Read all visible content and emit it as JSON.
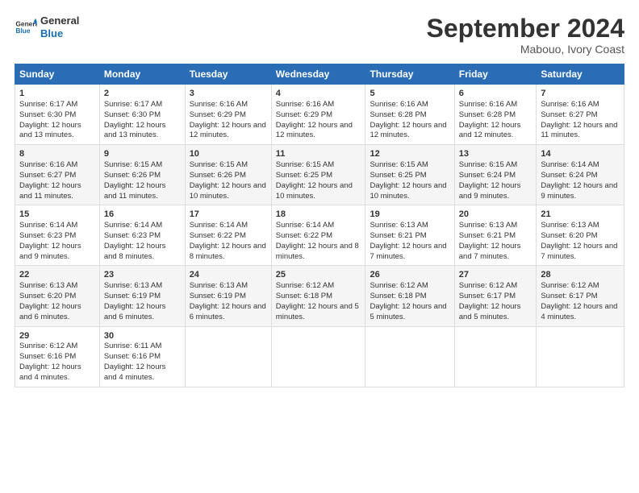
{
  "logo": {
    "text1": "General",
    "text2": "Blue"
  },
  "title": "September 2024",
  "subtitle": "Mabouo, Ivory Coast",
  "days_header": [
    "Sunday",
    "Monday",
    "Tuesday",
    "Wednesday",
    "Thursday",
    "Friday",
    "Saturday"
  ],
  "weeks": [
    [
      {
        "day": "1",
        "sunrise": "6:17 AM",
        "sunset": "6:30 PM",
        "daylight": "12 hours and 13 minutes."
      },
      {
        "day": "2",
        "sunrise": "6:17 AM",
        "sunset": "6:30 PM",
        "daylight": "12 hours and 13 minutes."
      },
      {
        "day": "3",
        "sunrise": "6:16 AM",
        "sunset": "6:29 PM",
        "daylight": "12 hours and 12 minutes."
      },
      {
        "day": "4",
        "sunrise": "6:16 AM",
        "sunset": "6:29 PM",
        "daylight": "12 hours and 12 minutes."
      },
      {
        "day": "5",
        "sunrise": "6:16 AM",
        "sunset": "6:28 PM",
        "daylight": "12 hours and 12 minutes."
      },
      {
        "day": "6",
        "sunrise": "6:16 AM",
        "sunset": "6:28 PM",
        "daylight": "12 hours and 12 minutes."
      },
      {
        "day": "7",
        "sunrise": "6:16 AM",
        "sunset": "6:27 PM",
        "daylight": "12 hours and 11 minutes."
      }
    ],
    [
      {
        "day": "8",
        "sunrise": "6:16 AM",
        "sunset": "6:27 PM",
        "daylight": "12 hours and 11 minutes."
      },
      {
        "day": "9",
        "sunrise": "6:15 AM",
        "sunset": "6:26 PM",
        "daylight": "12 hours and 11 minutes."
      },
      {
        "day": "10",
        "sunrise": "6:15 AM",
        "sunset": "6:26 PM",
        "daylight": "12 hours and 10 minutes."
      },
      {
        "day": "11",
        "sunrise": "6:15 AM",
        "sunset": "6:25 PM",
        "daylight": "12 hours and 10 minutes."
      },
      {
        "day": "12",
        "sunrise": "6:15 AM",
        "sunset": "6:25 PM",
        "daylight": "12 hours and 10 minutes."
      },
      {
        "day": "13",
        "sunrise": "6:15 AM",
        "sunset": "6:24 PM",
        "daylight": "12 hours and 9 minutes."
      },
      {
        "day": "14",
        "sunrise": "6:14 AM",
        "sunset": "6:24 PM",
        "daylight": "12 hours and 9 minutes."
      }
    ],
    [
      {
        "day": "15",
        "sunrise": "6:14 AM",
        "sunset": "6:23 PM",
        "daylight": "12 hours and 9 minutes."
      },
      {
        "day": "16",
        "sunrise": "6:14 AM",
        "sunset": "6:23 PM",
        "daylight": "12 hours and 8 minutes."
      },
      {
        "day": "17",
        "sunrise": "6:14 AM",
        "sunset": "6:22 PM",
        "daylight": "12 hours and 8 minutes."
      },
      {
        "day": "18",
        "sunrise": "6:14 AM",
        "sunset": "6:22 PM",
        "daylight": "12 hours and 8 minutes."
      },
      {
        "day": "19",
        "sunrise": "6:13 AM",
        "sunset": "6:21 PM",
        "daylight": "12 hours and 7 minutes."
      },
      {
        "day": "20",
        "sunrise": "6:13 AM",
        "sunset": "6:21 PM",
        "daylight": "12 hours and 7 minutes."
      },
      {
        "day": "21",
        "sunrise": "6:13 AM",
        "sunset": "6:20 PM",
        "daylight": "12 hours and 7 minutes."
      }
    ],
    [
      {
        "day": "22",
        "sunrise": "6:13 AM",
        "sunset": "6:20 PM",
        "daylight": "12 hours and 6 minutes."
      },
      {
        "day": "23",
        "sunrise": "6:13 AM",
        "sunset": "6:19 PM",
        "daylight": "12 hours and 6 minutes."
      },
      {
        "day": "24",
        "sunrise": "6:13 AM",
        "sunset": "6:19 PM",
        "daylight": "12 hours and 6 minutes."
      },
      {
        "day": "25",
        "sunrise": "6:12 AM",
        "sunset": "6:18 PM",
        "daylight": "12 hours and 5 minutes."
      },
      {
        "day": "26",
        "sunrise": "6:12 AM",
        "sunset": "6:18 PM",
        "daylight": "12 hours and 5 minutes."
      },
      {
        "day": "27",
        "sunrise": "6:12 AM",
        "sunset": "6:17 PM",
        "daylight": "12 hours and 5 minutes."
      },
      {
        "day": "28",
        "sunrise": "6:12 AM",
        "sunset": "6:17 PM",
        "daylight": "12 hours and 4 minutes."
      }
    ],
    [
      {
        "day": "29",
        "sunrise": "6:12 AM",
        "sunset": "6:16 PM",
        "daylight": "12 hours and 4 minutes."
      },
      {
        "day": "30",
        "sunrise": "6:11 AM",
        "sunset": "6:16 PM",
        "daylight": "12 hours and 4 minutes."
      },
      null,
      null,
      null,
      null,
      null
    ]
  ]
}
